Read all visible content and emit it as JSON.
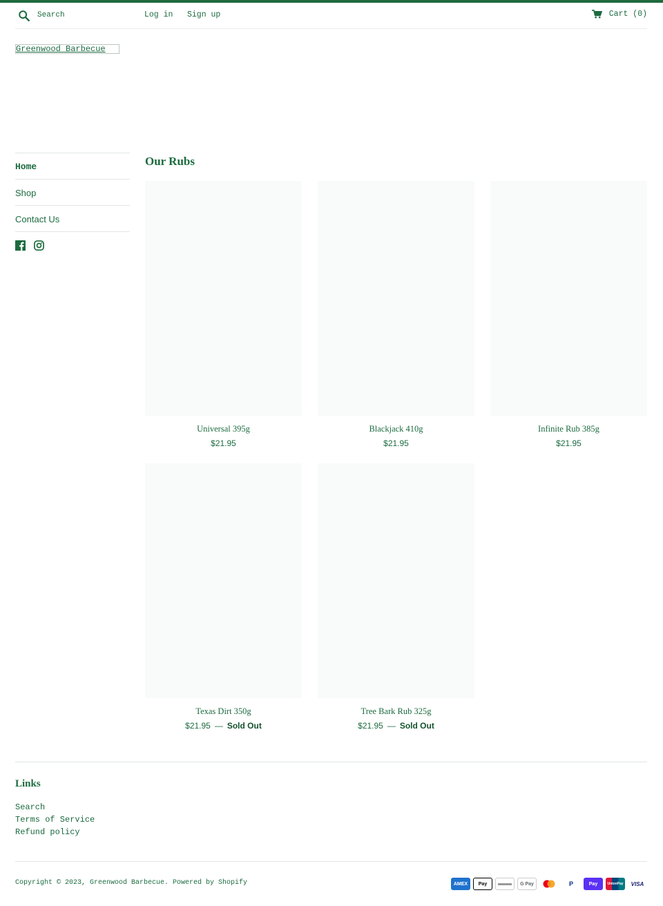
{
  "colors": {
    "accent": "#1f6a3e",
    "text": "#1c6b3f",
    "placeholder_bg": "#f9fafa"
  },
  "header": {
    "search_placeholder": "Search",
    "login_label": "Log in",
    "signup_label": "Sign up",
    "cart_label": "Cart (0)"
  },
  "logo": {
    "text": "Greenwood Barbecue"
  },
  "sidebar": {
    "items": [
      {
        "label": "Home"
      },
      {
        "label": "Shop"
      },
      {
        "label": "Contact Us"
      }
    ],
    "social": [
      "facebook-icon",
      "instagram-icon"
    ]
  },
  "collection": {
    "title": "Our Rubs",
    "products": [
      {
        "title": "Universal 395g",
        "price": "$21.95",
        "status": ""
      },
      {
        "title": "Blackjack 410g",
        "price": "$21.95",
        "status": ""
      },
      {
        "title": "Infinite Rub 385g",
        "price": "$21.95",
        "status": ""
      },
      {
        "title": "Texas Dirt 350g",
        "price": "$21.95",
        "status": "Sold Out"
      },
      {
        "title": "Tree Bark Rub 325g",
        "price": "$21.95",
        "status": "Sold Out"
      }
    ]
  },
  "footer": {
    "links_title": "Links",
    "links": [
      {
        "label": "Search"
      },
      {
        "label": "Terms of Service"
      },
      {
        "label": "Refund policy"
      }
    ],
    "copyright": "Copyright © 2023, Greenwood Barbecue. Powered by Shopify",
    "payments": [
      {
        "label": "AMEX",
        "icon": "amex-icon"
      },
      {
        "label": "Pay",
        "icon": "apple-pay-icon"
      },
      {
        "label": "",
        "icon": "diners-club-icon"
      },
      {
        "label": "G Pay",
        "icon": "google-pay-icon"
      },
      {
        "label": "",
        "icon": "mastercard-icon"
      },
      {
        "label": "P",
        "icon": "paypal-icon"
      },
      {
        "label": "Pay",
        "icon": "shop-pay-icon"
      },
      {
        "label": "UnionPay",
        "icon": "unionpay-icon"
      },
      {
        "label": "VISA",
        "icon": "visa-icon"
      }
    ]
  }
}
